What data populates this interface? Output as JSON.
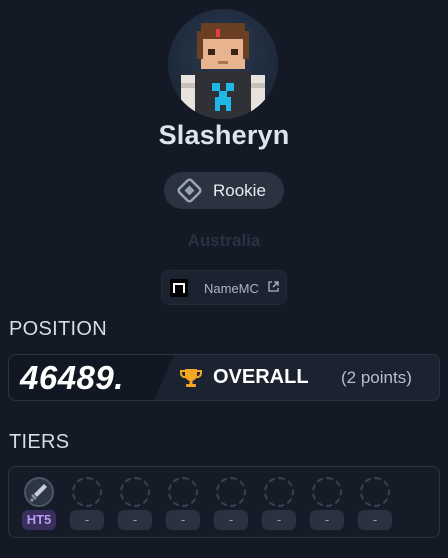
{
  "player": {
    "name": "Slasheryn",
    "rank": "Rookie",
    "region": "Australia"
  },
  "links": {
    "namemc_label": "NameMC"
  },
  "position": {
    "section_title": "POSITION",
    "number": "46489.",
    "category": "OVERALL",
    "points_text": "(2 points)"
  },
  "tiers": {
    "section_title": "TIERS",
    "slots": [
      {
        "label": "HT5",
        "icon": "sword-icon",
        "active": true
      },
      {
        "label": "-",
        "active": false
      },
      {
        "label": "-",
        "active": false
      },
      {
        "label": "-",
        "active": false
      },
      {
        "label": "-",
        "active": false
      },
      {
        "label": "-",
        "active": false
      },
      {
        "label": "-",
        "active": false
      },
      {
        "label": "-",
        "active": false
      }
    ]
  },
  "colors": {
    "background": "#141a25",
    "trophy": "#f5a623",
    "tier_active": "#b89cf2",
    "avatar_creeper": "#1fb7e6"
  }
}
